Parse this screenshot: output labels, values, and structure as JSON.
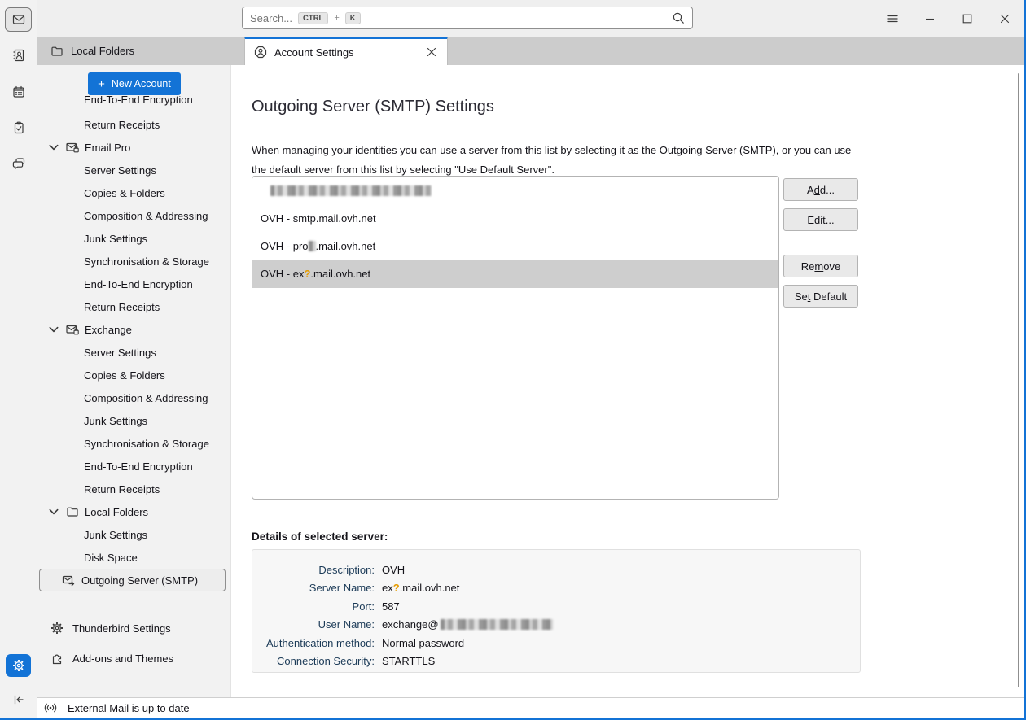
{
  "window": {
    "accent_color": "#1373d6",
    "controls": [
      "menu",
      "minimize",
      "maximize",
      "close"
    ]
  },
  "toolbar": {
    "search_placeholder": "Search...",
    "shortcut": {
      "key1": "CTRL",
      "plus": "+",
      "key2": "K"
    }
  },
  "tab_strip": {
    "folder_header": "Local Folders",
    "active_tab": "Account Settings"
  },
  "sidebar": {
    "new_account": "New Account",
    "tree": [
      {
        "label": "End-To-End Encryption",
        "level": 2,
        "clipped": true
      },
      {
        "label": "Return Receipts",
        "level": 2
      },
      {
        "label": "Email Pro",
        "level": 1,
        "chevron": true,
        "icon": "mail-account"
      },
      {
        "label": "Server Settings",
        "level": 2
      },
      {
        "label": "Copies & Folders",
        "level": 2
      },
      {
        "label": "Composition & Addressing",
        "level": 2
      },
      {
        "label": "Junk Settings",
        "level": 2
      },
      {
        "label": "Synchronisation & Storage",
        "level": 2
      },
      {
        "label": "End-To-End Encryption",
        "level": 2
      },
      {
        "label": "Return Receipts",
        "level": 2
      },
      {
        "label": "Exchange",
        "level": 1,
        "chevron": true,
        "icon": "mail-account"
      },
      {
        "label": "Server Settings",
        "level": 2
      },
      {
        "label": "Copies & Folders",
        "level": 2
      },
      {
        "label": "Composition & Addressing",
        "level": 2
      },
      {
        "label": "Junk Settings",
        "level": 2
      },
      {
        "label": "Synchronisation & Storage",
        "level": 2
      },
      {
        "label": "End-To-End Encryption",
        "level": 2
      },
      {
        "label": "Return Receipts",
        "level": 2
      },
      {
        "label": "Local Folders",
        "level": 1,
        "chevron": true,
        "icon": "folder"
      },
      {
        "label": "Junk Settings",
        "level": 2
      },
      {
        "label": "Disk Space",
        "level": 2
      },
      {
        "label": "Outgoing Server (SMTP)",
        "level": 2,
        "icon": "outgoing-server",
        "selected": true
      }
    ],
    "footer": [
      {
        "icon": "gear",
        "label": "Thunderbird Settings"
      },
      {
        "icon": "puzzle",
        "label": "Add-ons and Themes"
      }
    ]
  },
  "main": {
    "title": "Outgoing Server (SMTP) Settings",
    "description": "When managing your identities you can use a server from this list by selecting it as the Outgoing Server (SMTP), or you can use the default server from this list by selecting \"Use Default Server\".",
    "server_list": [
      {
        "redacted": true
      },
      {
        "text": "OVH - smtp.mail.ovh.net"
      },
      {
        "prefix": "OVH - pro",
        "redacted_char": true,
        "suffix": ".mail.ovh.net"
      },
      {
        "prefix": "OVH - ex",
        "highlight_char": "?",
        "suffix": ".mail.ovh.net",
        "selected": true
      }
    ],
    "buttons": [
      {
        "pre": "A",
        "key": "d",
        "post": "d..."
      },
      {
        "pre": "",
        "key": "E",
        "post": "dit..."
      },
      {
        "pre": "Re",
        "key": "m",
        "post": "ove"
      },
      {
        "pre": "Se",
        "key": "t",
        "post": " Default"
      }
    ],
    "details_heading": "Details of selected server:",
    "highlight_color": "#e59b00",
    "details": [
      {
        "label": "Description:",
        "value": "OVH"
      },
      {
        "label": "Server Name:",
        "prefix": "ex",
        "highlight_char": "?",
        "suffix": ".mail.ovh.net"
      },
      {
        "label": "Port:",
        "value": "587"
      },
      {
        "label": "User Name:",
        "value": "exchange@",
        "redacted_after": true
      },
      {
        "label": "Authentication method:",
        "value": "Normal password"
      },
      {
        "label": "Connection Security:",
        "value": "STARTTLS"
      }
    ]
  },
  "statusbar": {
    "text": "External Mail is up to date"
  }
}
